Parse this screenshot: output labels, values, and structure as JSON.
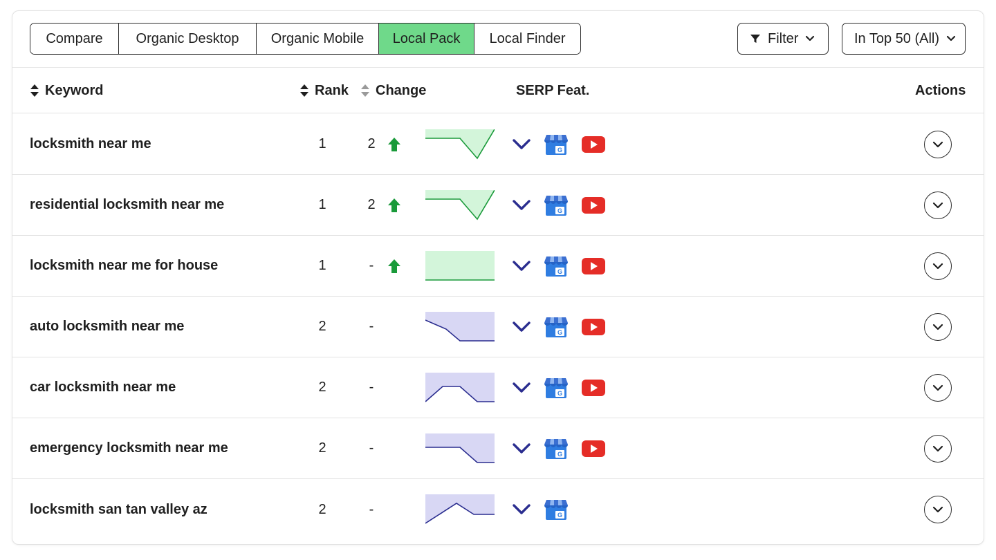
{
  "tabs": [
    {
      "label": "Compare",
      "active": false
    },
    {
      "label": "Organic Desktop",
      "active": false
    },
    {
      "label": "Organic Mobile",
      "active": false
    },
    {
      "label": "Local Pack",
      "active": true
    },
    {
      "label": "Local Finder",
      "active": false
    }
  ],
  "filter": {
    "label": "Filter"
  },
  "top_filter": {
    "label": "In Top 50 (All)"
  },
  "columns": {
    "keyword": "Keyword",
    "rank": "Rank",
    "change": "Change",
    "serp": "SERP Feat.",
    "actions": "Actions"
  },
  "colors": {
    "active_tab": "#6fd98a",
    "up_arrow": "#1a9a3a",
    "spark_up_fill": "#d3f5da",
    "spark_up_line": "#1a9a3a",
    "spark_flat_fill": "#d8d7f4",
    "spark_flat_line": "#2a2d8f",
    "chevron": "#2a2d8f",
    "youtube": "#e52d27",
    "gbp": "#2f7de1"
  },
  "rows": [
    {
      "keyword": "locksmith near me",
      "rank": "1",
      "change": "2",
      "trend": "up",
      "serp": [
        "expand-chevron",
        "google-business-profile",
        "youtube"
      ]
    },
    {
      "keyword": "residential locksmith near me",
      "rank": "1",
      "change": "2",
      "trend": "up",
      "serp": [
        "expand-chevron",
        "google-business-profile",
        "youtube"
      ]
    },
    {
      "keyword": "locksmith near me for house",
      "rank": "1",
      "change": "-",
      "trend": "up",
      "serp": [
        "expand-chevron",
        "google-business-profile",
        "youtube"
      ]
    },
    {
      "keyword": "auto locksmith near me",
      "rank": "2",
      "change": "-",
      "trend": "none",
      "serp": [
        "expand-chevron",
        "google-business-profile",
        "youtube"
      ]
    },
    {
      "keyword": "car locksmith near me",
      "rank": "2",
      "change": "-",
      "trend": "none",
      "serp": [
        "expand-chevron",
        "google-business-profile",
        "youtube"
      ]
    },
    {
      "keyword": "emergency locksmith near me",
      "rank": "2",
      "change": "-",
      "trend": "none",
      "serp": [
        "expand-chevron",
        "google-business-profile",
        "youtube"
      ]
    },
    {
      "keyword": "locksmith san tan valley az",
      "rank": "2",
      "change": "-",
      "trend": "none",
      "serp": [
        "expand-chevron",
        "google-business-profile"
      ]
    }
  ]
}
